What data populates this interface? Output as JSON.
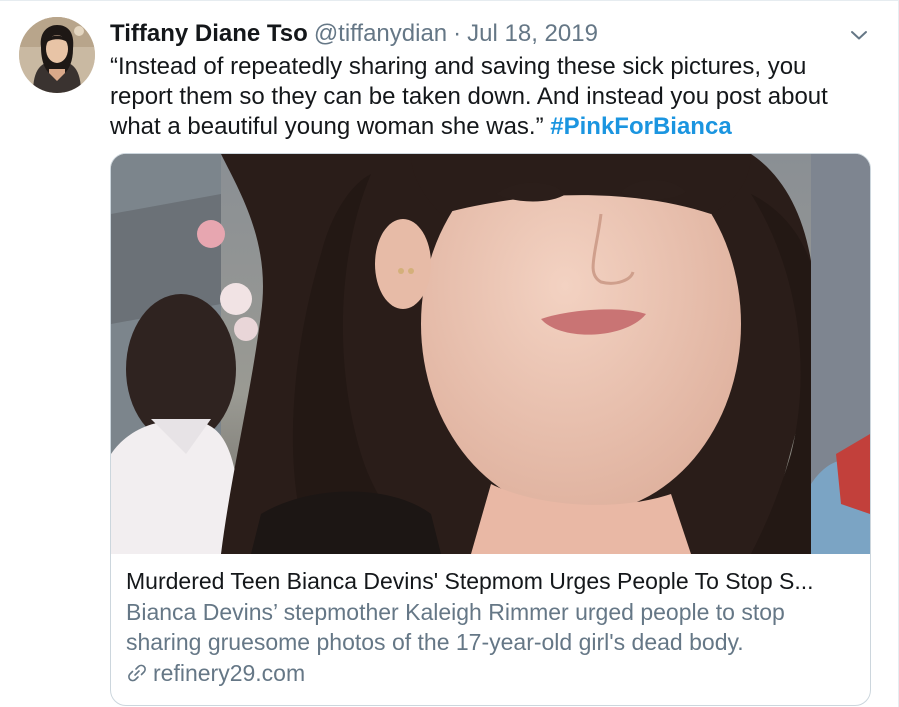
{
  "tweet": {
    "author_name": "Tiffany Diane Tso",
    "handle": "@tiffanydian",
    "separator": "·",
    "date": "Jul 18, 2019",
    "text": "“Instead of repeatedly sharing and saving these sick pictures, you report them so they can be taken down. And instead you post about what a beautiful young woman she was.”",
    "hashtag": "#PinkForBianca",
    "avatar_icon": "avatar-photo",
    "menu_icon": "chevron-down-icon"
  },
  "card": {
    "image_icon": "article-photo",
    "title": "Murdered Teen Bianca Devins' Stepmom Urges People To Stop S...",
    "description": "Bianca Devins’ stepmother Kaleigh Rimmer urged people to stop sharing gruesome photos of the 17-year-old girl's dead body.",
    "domain": "refinery29.com",
    "domain_icon": "link-icon"
  },
  "colors": {
    "text": "#14171a",
    "secondary": "#657786",
    "link": "#1b95e0",
    "border": "#ccd6dd"
  }
}
